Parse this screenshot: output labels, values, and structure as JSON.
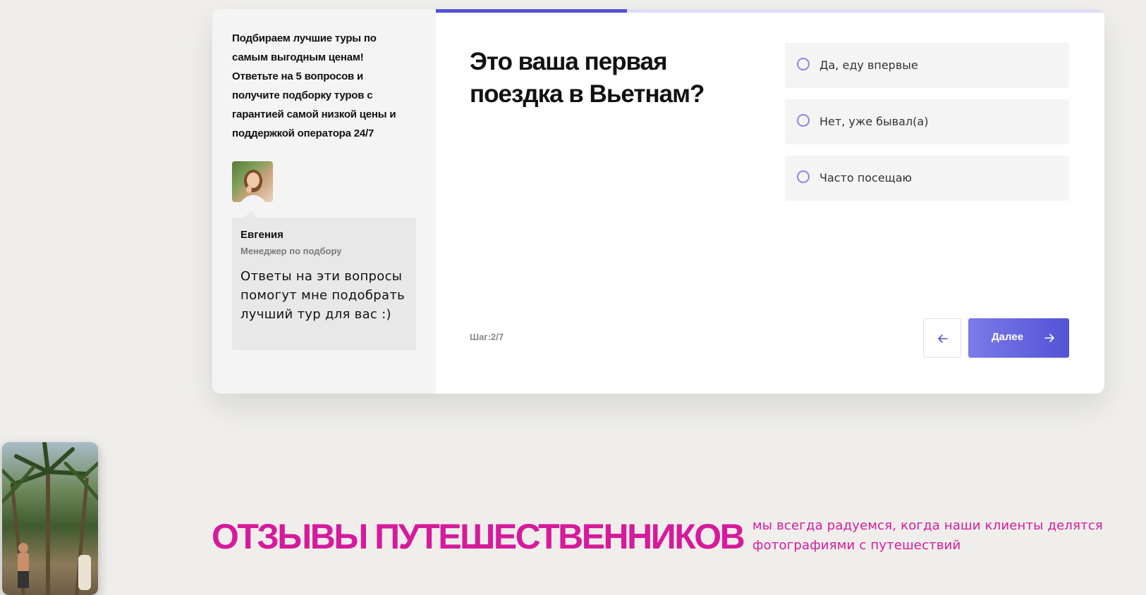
{
  "sidebar": {
    "intro": "Подбираем лучшие туры по самым выгодным ценам! Ответьте на 5 вопросов и получите подборку туров с гарантией самой низкой цены и поддержкой оператора 24/7",
    "manager": {
      "name": "Евгения",
      "role": "Менеджер по подбору",
      "message": "Ответы на эти вопросы помогут мне подобрать лучший тур для вас :)"
    }
  },
  "quiz": {
    "progress": 0.286,
    "question": "Это ваша первая поездка в Вьетнам?",
    "options": [
      {
        "label": "Да, еду впервые",
        "selected": false
      },
      {
        "label": "Нет, уже бывал(а)",
        "selected": false
      },
      {
        "label": "Часто посещаю",
        "selected": false
      }
    ],
    "step_label": "Шаг:2/7",
    "back_icon": "arrow-left-icon",
    "next_label": "Далее",
    "next_icon": "arrow-right-icon"
  },
  "reviews": {
    "title": "ОТЗЫВЫ ПУТЕШЕСТВЕННИКОВ",
    "subtitle": "мы всегда радуемся, когда наши клиенты делятся фотографиями с путешествий"
  },
  "colors": {
    "accent": "#5353d6",
    "reviews_pink": "#d61a9c",
    "progress_track": "#dcdcf6"
  }
}
